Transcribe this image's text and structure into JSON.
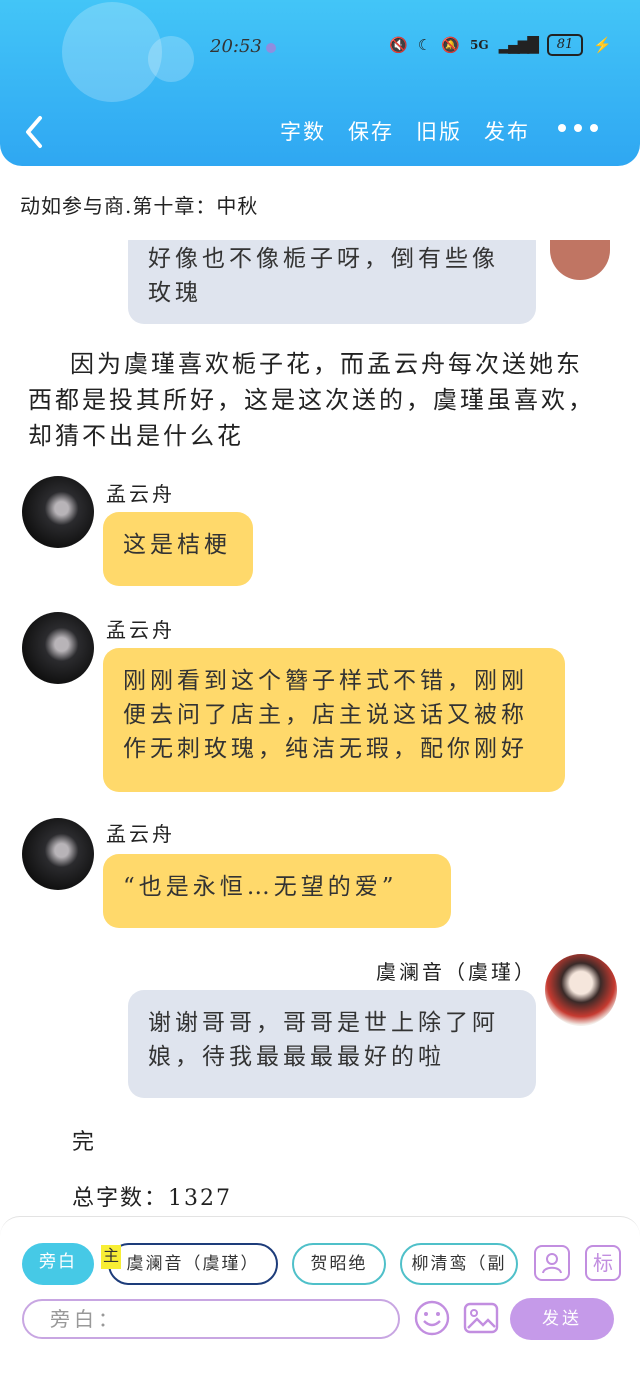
{
  "status_bar": {
    "time": "20:53",
    "battery": "81",
    "network": "5G"
  },
  "toolbar": {
    "word_count": "字数",
    "save": "保存",
    "old_version": "旧版",
    "publish": "发布"
  },
  "document": {
    "title": "动如参与商.第十章：中秋"
  },
  "messages": {
    "prev_bubble": "好像也不像栀子呀，倒有些像玫瑰",
    "narration_1": "因为虞瑾喜欢栀子花，而孟云舟每次送她东西都是投其所好，这是这次送的，虞瑾虽喜欢，却猜不出是什么花",
    "speaker_1": "孟云舟",
    "msg_1": "这是桔梗",
    "speaker_2": "孟云舟",
    "msg_2": "刚刚看到这个簪子样式不错，刚刚便去问了店主，店主说这话又被称作无刺玫瑰，纯洁无瑕，配你刚好",
    "speaker_3": "孟云舟",
    "msg_3": "“也是永恒…无望的爱”",
    "speaker_4": "虞澜音（虞瑾）",
    "msg_4": "谢谢哥哥，哥哥是世上除了阿娘，待我最最最最好的啦",
    "end_text": "完",
    "total_words": "总字数：1327"
  },
  "bottom_panel": {
    "chips": {
      "narrator": "旁白",
      "main_tag": "主",
      "char_1": "虞澜音（虞瑾）",
      "char_2": "贺昭绝",
      "char_3": "柳清鸾（副"
    },
    "input_placeholder": "旁白：",
    "send": "发送",
    "tag_icon_label": "标"
  },
  "colors": {
    "header": "#2fa7f2",
    "speaker_bubble": "#ffd96b",
    "self_bubble": "#dfe4ee",
    "accent": "#c59ae9"
  }
}
